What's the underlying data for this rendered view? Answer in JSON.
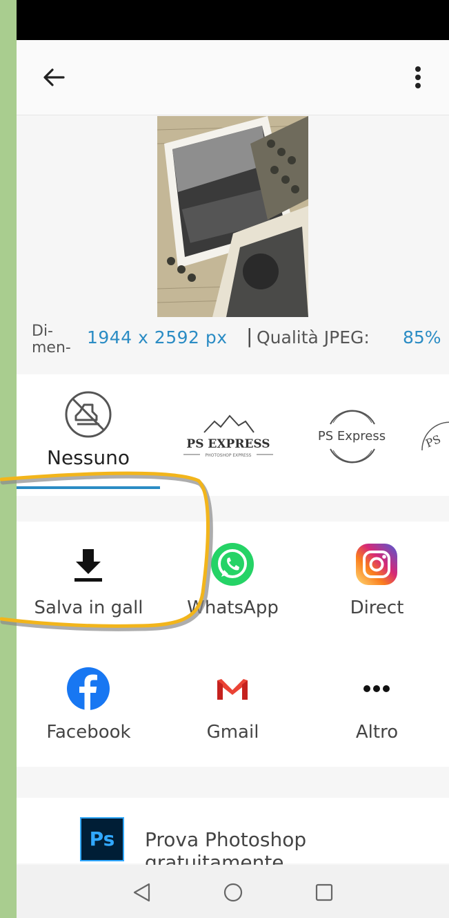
{
  "info": {
    "dimension_label": "Di-\nmen-",
    "dimension_value": "1944 x 2592 px",
    "separator": "|",
    "quality_label": "Qualità JPEG:",
    "quality_value": "85%"
  },
  "watermarks": {
    "none_label": "Nessuno",
    "ps_express_logo_text": "PS EXPRESS",
    "ps_express_sub_text": "PHOTOSHOP EXPRESS",
    "ps_express_stamp_text": "PS Express",
    "partial_text": "PS"
  },
  "share": {
    "items": [
      {
        "label": "Salva in gall",
        "icon": "download-icon"
      },
      {
        "label": "WhatsApp",
        "icon": "whatsapp-icon"
      },
      {
        "label": "Direct",
        "icon": "instagram-icon"
      },
      {
        "label": "Facebook",
        "icon": "facebook-icon"
      },
      {
        "label": "Gmail",
        "icon": "gmail-icon"
      },
      {
        "label": "Altro",
        "icon": "more-horizontal-icon"
      }
    ]
  },
  "promo": {
    "logo_text": "Ps",
    "text": "Prova Photoshop gratuitamente"
  },
  "colors": {
    "accent": "#2b8cc4",
    "highlight": "#f2b51b",
    "outer_background": "#a9cd8f"
  }
}
